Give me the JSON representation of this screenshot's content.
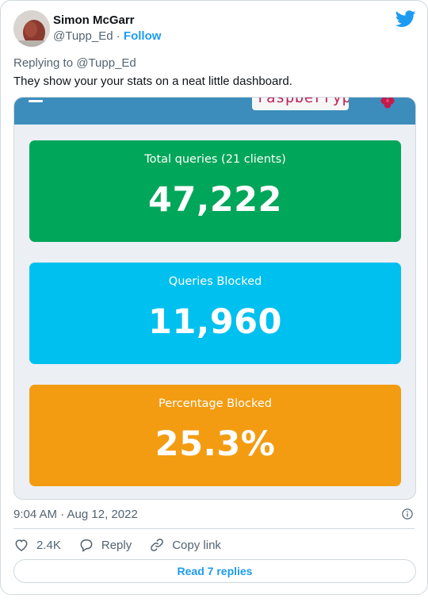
{
  "author": {
    "name": "Simon McGarr",
    "handle": "@Tupp_Ed",
    "follow_label": "Follow"
  },
  "tweet": {
    "replying_to": "Replying to @Tupp_Ed",
    "text": "They show your your stats on a neat little dashboard.",
    "timestamp": "9:04 AM · Aug 12, 2022"
  },
  "dashboard": {
    "hostname": "raspberrypi",
    "tiles": [
      {
        "label": "Total queries (21 clients)",
        "value": "47,222",
        "color": "#00a65a"
      },
      {
        "label": "Queries Blocked",
        "value": "11,960",
        "color": "#00c0ef"
      },
      {
        "label": "Percentage Blocked",
        "value": "25.3%",
        "color": "#f39c12"
      }
    ],
    "header_color": "#3c8dbc"
  },
  "actions": {
    "like_count": "2.4K",
    "reply_label": "Reply",
    "copy_label": "Copy link",
    "read_replies_label": "Read 7 replies"
  },
  "colors": {
    "accent": "#1d9bf0",
    "secondary_text": "#536471"
  },
  "icons": [
    "twitter-bird-icon",
    "heart-icon",
    "reply-icon",
    "link-icon",
    "info-icon",
    "hamburger-icon",
    "raspberry-pi-icon"
  ]
}
